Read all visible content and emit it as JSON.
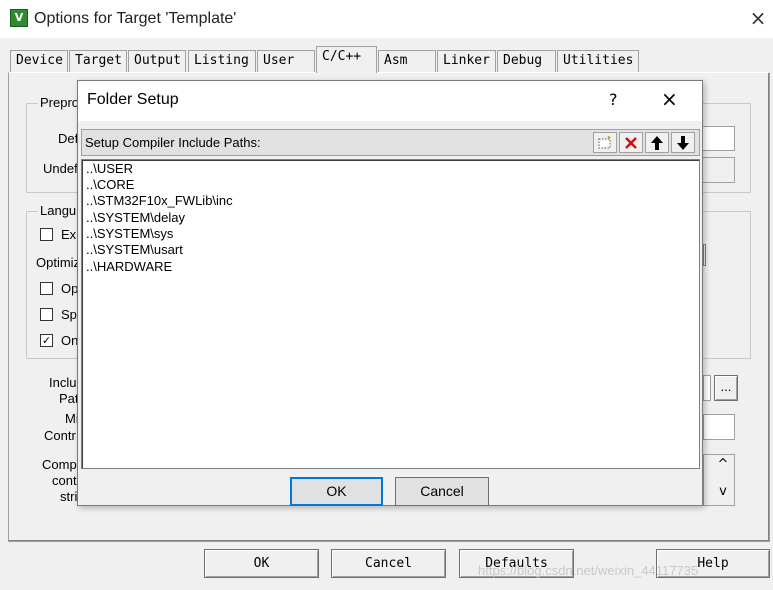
{
  "window": {
    "title": "Options for Target 'Template'",
    "icon_text": "V",
    "close_glyph": "×"
  },
  "tabs": [
    {
      "label": "Device",
      "active": false
    },
    {
      "label": "Target",
      "active": false
    },
    {
      "label": "Output",
      "active": false
    },
    {
      "label": "Listing",
      "active": false
    },
    {
      "label": "User",
      "active": false
    },
    {
      "label": "C/C++",
      "active": true
    },
    {
      "label": "Asm",
      "active": false
    },
    {
      "label": "Linker",
      "active": false
    },
    {
      "label": "Debug",
      "active": false
    },
    {
      "label": "Utilities",
      "active": false
    }
  ],
  "background": {
    "preprocessor_group": "Prepro",
    "define_label": "Def",
    "undefine_label": "Undef",
    "language_group": "Langu",
    "checkbox_ex": "Ex",
    "optimize_label": "Optimiz",
    "checkbox_op": "Op",
    "checkbox_sp": "Sp",
    "checkbox_on": "On",
    "include_label": "Inclu",
    "paths_label": "Pat",
    "misc_label": "Mi",
    "controls_label": "Contr",
    "compiler_label": "Comp",
    "control_label": "cont",
    "string_label": "stri",
    "browse_button": "...",
    "scroll_up": "^",
    "scroll_down": "v"
  },
  "footer": {
    "ok": "OK",
    "cancel": "Cancel",
    "defaults": "Defaults",
    "help": "Help"
  },
  "dialog": {
    "title": "Folder Setup",
    "help_glyph": "?",
    "close_glyph": "×",
    "header_label": "Setup Compiler Include Paths:",
    "paths": [
      "..\\USER",
      "..\\CORE",
      "..\\STM32F10x_FWLib\\inc",
      "..\\SYSTEM\\delay",
      "..\\SYSTEM\\sys",
      "..\\SYSTEM\\usart",
      "..\\HARDWARE"
    ],
    "ok": "OK",
    "cancel": "Cancel"
  },
  "toolbar_icons": [
    "new-folder-icon",
    "delete-icon",
    "move-up-icon",
    "move-down-icon"
  ],
  "watermark": "https://blog.csdn.net/weixin_44117735"
}
